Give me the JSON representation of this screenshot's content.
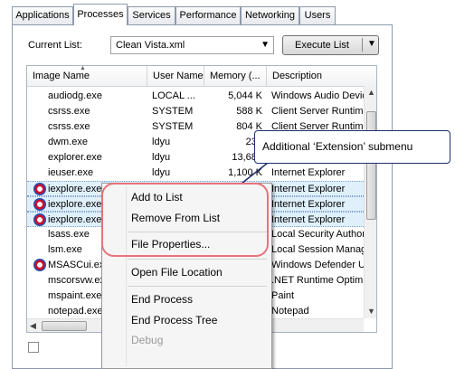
{
  "tabs": [
    "Applications",
    "Processes",
    "Services",
    "Performance",
    "Networking",
    "Users"
  ],
  "active_tab": "Processes",
  "current_list": {
    "label": "Current List:",
    "value": "Clean Vista.xml"
  },
  "execute_button": "Execute List",
  "columns": [
    "Image Name",
    "User Name",
    "Memory (...",
    "Description"
  ],
  "rows": [
    {
      "name": "audiodg.exe",
      "user": "LOCAL ...",
      "memory": "5,044 K",
      "desc": "Windows Audio Devic"
    },
    {
      "name": "csrss.exe",
      "user": "SYSTEM",
      "memory": "588 K",
      "desc": "Client Server Runtim"
    },
    {
      "name": "csrss.exe",
      "user": "SYSTEM",
      "memory": "804 K",
      "desc": "Client Server Runtim"
    },
    {
      "name": "dwm.exe",
      "user": "ldyu",
      "memory": "232",
      "desc": ""
    },
    {
      "name": "explorer.exe",
      "user": "ldyu",
      "memory": "13,680",
      "desc": ""
    },
    {
      "name": "ieuser.exe",
      "user": "ldyu",
      "memory": "1,100 K",
      "desc": "Internet Explorer"
    },
    {
      "name": "iexplore.exe",
      "user": "",
      "memory": "",
      "desc": "Internet Explorer"
    },
    {
      "name": "iexplore.exe",
      "user": "",
      "memory": "",
      "desc": "Internet Explorer"
    },
    {
      "name": "iexplore.exe",
      "user": "",
      "memory": "",
      "desc": "Internet Explorer"
    },
    {
      "name": "lsass.exe",
      "user": "",
      "memory": "",
      "desc": "Local Security Author"
    },
    {
      "name": "lsm.exe",
      "user": "",
      "memory": "",
      "desc": "Local Session Manage"
    },
    {
      "name": "MSASCui.exe",
      "user": "",
      "memory": "",
      "desc": "Windows Defender U"
    },
    {
      "name": "mscorsvw.exe",
      "user": "",
      "memory": "",
      "desc": ".NET Runtime Optimiz"
    },
    {
      "name": "mspaint.exe",
      "user": "",
      "memory": "",
      "desc": "Paint"
    },
    {
      "name": "notepad.exe",
      "user": "",
      "memory": "",
      "desc": "Notepad"
    }
  ],
  "menu": {
    "add": "Add to List",
    "remove": "Remove From List",
    "props": "File Properties...",
    "open": "Open File Location",
    "end": "End Process",
    "end_tree": "End Process Tree",
    "debug": "Debug"
  },
  "callout": "Additional ‘Extension’ submenu",
  "colors": {
    "highlight": "#e8737c",
    "callout_border": "#1f2f6e",
    "selected_row": "#dff0fb"
  }
}
